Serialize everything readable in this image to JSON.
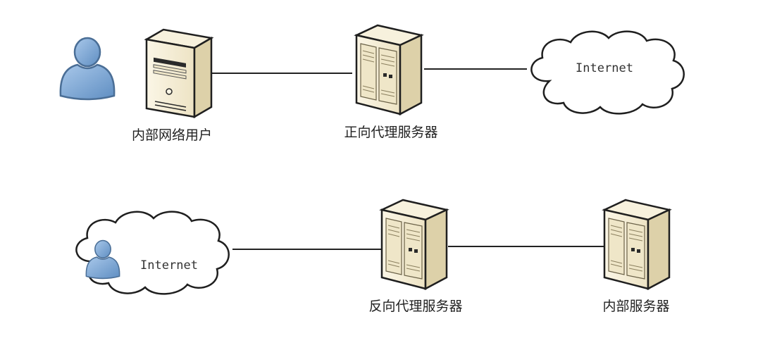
{
  "forward": {
    "client_label": "内部网络用户",
    "proxy_label": "正向代理服务器",
    "cloud_label": "Internet"
  },
  "reverse": {
    "cloud_label": "Internet",
    "proxy_label": "反向代理服务器",
    "server_label": "内部服务器"
  },
  "icons": {
    "user": "user-icon",
    "workstation": "desktop-tower-icon",
    "server": "server-rack-icon",
    "cloud": "cloud-icon"
  },
  "colors": {
    "server_face": "#F4EDD6",
    "server_side": "#DDD1A9",
    "outline": "#1F1F1F",
    "user_fill": "#7AA7D6",
    "user_stroke": "#4A6E96",
    "line": "#222222"
  }
}
